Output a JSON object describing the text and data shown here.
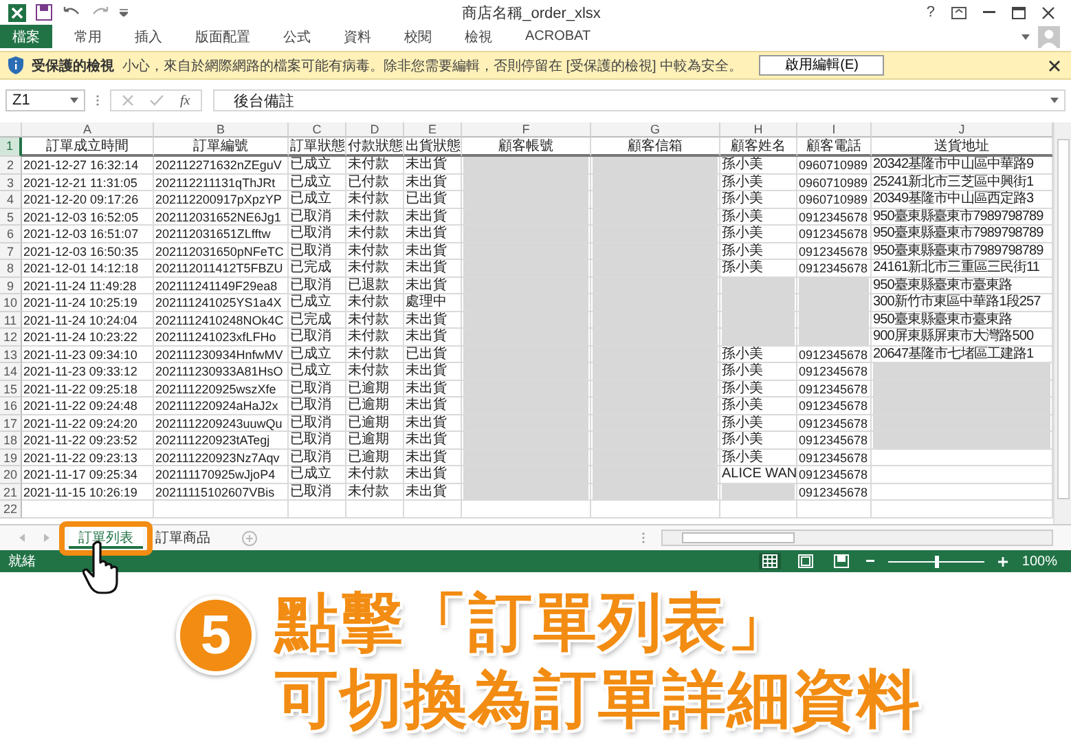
{
  "window": {
    "title": "商店名稱_order_xlsx",
    "help": "?"
  },
  "ribbon": {
    "tabs": [
      {
        "label": "檔案",
        "kind": "file",
        "selected": false
      },
      {
        "label": "常用",
        "kind": "tab",
        "selected": false
      },
      {
        "label": "插入",
        "kind": "tab",
        "selected": false
      },
      {
        "label": "版面配置",
        "kind": "tab",
        "selected": false
      },
      {
        "label": "公式",
        "kind": "tab",
        "selected": false
      },
      {
        "label": "資料",
        "kind": "tab",
        "selected": false
      },
      {
        "label": "校閱",
        "kind": "tab",
        "selected": false
      },
      {
        "label": "檢視",
        "kind": "tab",
        "selected": false
      },
      {
        "label": "ACROBAT",
        "kind": "tab",
        "selected": false
      }
    ]
  },
  "protected_view_bar": {
    "title": "受保護的檢視",
    "message": "小心，來自於網際網路的檔案可能有病毒。除非您需要編輯，否則停留在 [受保護的檢視] 中較為安全。",
    "button": "啟用編輯(E)"
  },
  "formula_bar": {
    "name_box": "Z1",
    "function_button": "fx",
    "value": "後台備註"
  },
  "columns": [
    {
      "letter": "A",
      "heading": "訂單成立時間"
    },
    {
      "letter": "B",
      "heading": "訂單編號"
    },
    {
      "letter": "C",
      "heading": "訂單狀態"
    },
    {
      "letter": "D",
      "heading": "付款狀態"
    },
    {
      "letter": "E",
      "heading": "出貨狀態"
    },
    {
      "letter": "F",
      "heading": "顧客帳號"
    },
    {
      "letter": "G",
      "heading": "顧客信箱"
    },
    {
      "letter": "H",
      "heading": "顧客姓名"
    },
    {
      "letter": "I",
      "heading": "顧客電話"
    },
    {
      "letter": "J",
      "heading": "送貨地址"
    }
  ],
  "header_row": {
    "number": "1",
    "selected": true
  },
  "rows": [
    {
      "number": "2",
      "selected": false,
      "cells": [
        {
          "kind": "text",
          "text": "2021-12-27 16:32:14"
        },
        {
          "kind": "text",
          "text": "202112271632nZEguV"
        },
        {
          "kind": "text",
          "text": "已成立"
        },
        {
          "kind": "text",
          "text": "未付款"
        },
        {
          "kind": "text",
          "text": "未出貨"
        },
        {
          "kind": "blurred"
        },
        {
          "kind": "blurred"
        },
        {
          "kind": "text",
          "text": "孫小美"
        },
        {
          "kind": "text",
          "text": "0960710989"
        },
        {
          "kind": "text",
          "text": "20342基隆市中山區中華路9"
        }
      ]
    },
    {
      "number": "3",
      "selected": false,
      "cells": [
        {
          "kind": "text",
          "text": "2021-12-21 11:31:05"
        },
        {
          "kind": "text",
          "text": "202112211131qThJRt"
        },
        {
          "kind": "text",
          "text": "已成立"
        },
        {
          "kind": "text",
          "text": "已付款"
        },
        {
          "kind": "text",
          "text": "未出貨"
        },
        {
          "kind": "blurred"
        },
        {
          "kind": "blurred"
        },
        {
          "kind": "text",
          "text": "孫小美"
        },
        {
          "kind": "text",
          "text": "0960710989"
        },
        {
          "kind": "text",
          "text": "25241新北市三芝區中興街1"
        }
      ]
    },
    {
      "number": "4",
      "selected": false,
      "cells": [
        {
          "kind": "text",
          "text": "2021-12-20 09:17:26"
        },
        {
          "kind": "text",
          "text": "202112200917pXpzYP"
        },
        {
          "kind": "text",
          "text": "已成立"
        },
        {
          "kind": "text",
          "text": "未付款"
        },
        {
          "kind": "text",
          "text": "已出貨"
        },
        {
          "kind": "blurred"
        },
        {
          "kind": "blurred"
        },
        {
          "kind": "text",
          "text": "孫小美"
        },
        {
          "kind": "text",
          "text": "0960710989"
        },
        {
          "kind": "text",
          "text": "20349基隆市中山區西定路3"
        }
      ]
    },
    {
      "number": "5",
      "selected": false,
      "cells": [
        {
          "kind": "text",
          "text": "2021-12-03 16:52:05"
        },
        {
          "kind": "text",
          "text": "202112031652NE6Jg1"
        },
        {
          "kind": "text",
          "text": "已取消"
        },
        {
          "kind": "text",
          "text": "未付款"
        },
        {
          "kind": "text",
          "text": "未出貨"
        },
        {
          "kind": "blurred"
        },
        {
          "kind": "blurred"
        },
        {
          "kind": "text",
          "text": "孫小美"
        },
        {
          "kind": "text",
          "text": "0912345678"
        },
        {
          "kind": "text",
          "text": "950臺東縣臺東市7989798789"
        }
      ]
    },
    {
      "number": "6",
      "selected": false,
      "cells": [
        {
          "kind": "text",
          "text": "2021-12-03 16:51:07"
        },
        {
          "kind": "text",
          "text": "202112031651ZLfftw"
        },
        {
          "kind": "text",
          "text": "已取消"
        },
        {
          "kind": "text",
          "text": "未付款"
        },
        {
          "kind": "text",
          "text": "未出貨"
        },
        {
          "kind": "blurred"
        },
        {
          "kind": "blurred"
        },
        {
          "kind": "text",
          "text": "孫小美"
        },
        {
          "kind": "text",
          "text": "0912345678"
        },
        {
          "kind": "text",
          "text": "950臺東縣臺東市7989798789"
        }
      ]
    },
    {
      "number": "7",
      "selected": false,
      "cells": [
        {
          "kind": "text",
          "text": "2021-12-03 16:50:35"
        },
        {
          "kind": "text",
          "text": "202112031650pNFeTC"
        },
        {
          "kind": "text",
          "text": "已取消"
        },
        {
          "kind": "text",
          "text": "未付款"
        },
        {
          "kind": "text",
          "text": "未出貨"
        },
        {
          "kind": "blurred"
        },
        {
          "kind": "blurred"
        },
        {
          "kind": "text",
          "text": "孫小美"
        },
        {
          "kind": "text",
          "text": "0912345678"
        },
        {
          "kind": "text",
          "text": "950臺東縣臺東市7989798789"
        }
      ]
    },
    {
      "number": "8",
      "selected": false,
      "cells": [
        {
          "kind": "text",
          "text": "2021-12-01 14:12:18"
        },
        {
          "kind": "text",
          "text": "202112011412T5FBZU"
        },
        {
          "kind": "text",
          "text": "已完成"
        },
        {
          "kind": "text",
          "text": "未付款"
        },
        {
          "kind": "text",
          "text": "未出貨"
        },
        {
          "kind": "blurred"
        },
        {
          "kind": "blurred"
        },
        {
          "kind": "text",
          "text": "孫小美"
        },
        {
          "kind": "text",
          "text": "0912345678"
        },
        {
          "kind": "text",
          "text": "24161新北市三重區三民街11"
        }
      ]
    },
    {
      "number": "9",
      "selected": false,
      "cells": [
        {
          "kind": "text",
          "text": "2021-11-24 11:49:28"
        },
        {
          "kind": "text",
          "text": "202111241149F29ea8"
        },
        {
          "kind": "text",
          "text": "已取消"
        },
        {
          "kind": "text",
          "text": "已退款"
        },
        {
          "kind": "text",
          "text": "未出貨"
        },
        {
          "kind": "blurred"
        },
        {
          "kind": "blurred"
        },
        {
          "kind": "blurred"
        },
        {
          "kind": "blurred"
        },
        {
          "kind": "text",
          "text": "950臺東縣臺東市臺東路"
        }
      ]
    },
    {
      "number": "10",
      "selected": false,
      "cells": [
        {
          "kind": "text",
          "text": "2021-11-24 10:25:19"
        },
        {
          "kind": "text",
          "text": "202111241025YS1a4X"
        },
        {
          "kind": "text",
          "text": "已成立"
        },
        {
          "kind": "text",
          "text": "未付款"
        },
        {
          "kind": "text",
          "text": "處理中"
        },
        {
          "kind": "blurred"
        },
        {
          "kind": "blurred"
        },
        {
          "kind": "blurred"
        },
        {
          "kind": "blurred"
        },
        {
          "kind": "text",
          "text": "300新竹市東區中華路1段257"
        }
      ]
    },
    {
      "number": "11",
      "selected": false,
      "cells": [
        {
          "kind": "text",
          "text": "2021-11-24 10:24:04"
        },
        {
          "kind": "text",
          "text": "2021112410248NOk4C"
        },
        {
          "kind": "text",
          "text": "已完成"
        },
        {
          "kind": "text",
          "text": "未付款"
        },
        {
          "kind": "text",
          "text": "未出貨"
        },
        {
          "kind": "blurred"
        },
        {
          "kind": "blurred"
        },
        {
          "kind": "blurred"
        },
        {
          "kind": "blurred"
        },
        {
          "kind": "text",
          "text": "950臺東縣臺東市臺東路"
        }
      ]
    },
    {
      "number": "12",
      "selected": false,
      "cells": [
        {
          "kind": "text",
          "text": "2021-11-24 10:23:22"
        },
        {
          "kind": "text",
          "text": "202111241023xfLFHo"
        },
        {
          "kind": "text",
          "text": "已取消"
        },
        {
          "kind": "text",
          "text": "未付款"
        },
        {
          "kind": "text",
          "text": "未出貨"
        },
        {
          "kind": "blurred"
        },
        {
          "kind": "blurred"
        },
        {
          "kind": "blurred"
        },
        {
          "kind": "blurred"
        },
        {
          "kind": "text",
          "text": "900屏東縣屏東市大灣路500"
        }
      ]
    },
    {
      "number": "13",
      "selected": false,
      "cells": [
        {
          "kind": "text",
          "text": "2021-11-23 09:34:10"
        },
        {
          "kind": "text",
          "text": "202111230934HnfwMV"
        },
        {
          "kind": "text",
          "text": "已成立"
        },
        {
          "kind": "text",
          "text": "未付款"
        },
        {
          "kind": "text",
          "text": "已出貨"
        },
        {
          "kind": "blurred"
        },
        {
          "kind": "blurred"
        },
        {
          "kind": "text",
          "text": "孫小美"
        },
        {
          "kind": "text",
          "text": "0912345678"
        },
        {
          "kind": "text",
          "text": "20647基隆市七堵區工建路1"
        }
      ]
    },
    {
      "number": "14",
      "selected": false,
      "cells": [
        {
          "kind": "text",
          "text": "2021-11-23 09:33:12"
        },
        {
          "kind": "text",
          "text": "202111230933A81HsO"
        },
        {
          "kind": "text",
          "text": "已成立"
        },
        {
          "kind": "text",
          "text": "未付款"
        },
        {
          "kind": "text",
          "text": "未出貨"
        },
        {
          "kind": "blurred"
        },
        {
          "kind": "blurred"
        },
        {
          "kind": "text",
          "text": "孫小美"
        },
        {
          "kind": "text",
          "text": "0912345678"
        },
        {
          "kind": "blurred"
        }
      ]
    },
    {
      "number": "15",
      "selected": false,
      "cells": [
        {
          "kind": "text",
          "text": "2021-11-22 09:25:18"
        },
        {
          "kind": "text",
          "text": "202111220925wszXfe"
        },
        {
          "kind": "text",
          "text": "已取消"
        },
        {
          "kind": "text",
          "text": "已逾期"
        },
        {
          "kind": "text",
          "text": "未出貨"
        },
        {
          "kind": "blurred"
        },
        {
          "kind": "blurred"
        },
        {
          "kind": "text",
          "text": "孫小美"
        },
        {
          "kind": "text",
          "text": "0912345678"
        },
        {
          "kind": "blurred"
        }
      ]
    },
    {
      "number": "16",
      "selected": false,
      "cells": [
        {
          "kind": "text",
          "text": "2021-11-22 09:24:48"
        },
        {
          "kind": "text",
          "text": "202111220924aHaJ2x"
        },
        {
          "kind": "text",
          "text": "已取消"
        },
        {
          "kind": "text",
          "text": "已逾期"
        },
        {
          "kind": "text",
          "text": "未出貨"
        },
        {
          "kind": "blurred"
        },
        {
          "kind": "blurred"
        },
        {
          "kind": "text",
          "text": "孫小美"
        },
        {
          "kind": "text",
          "text": "0912345678"
        },
        {
          "kind": "blurred"
        }
      ]
    },
    {
      "number": "17",
      "selected": false,
      "cells": [
        {
          "kind": "text",
          "text": "2021-11-22 09:24:20"
        },
        {
          "kind": "text",
          "text": "2021112209243uuwQu"
        },
        {
          "kind": "text",
          "text": "已取消"
        },
        {
          "kind": "text",
          "text": "已逾期"
        },
        {
          "kind": "text",
          "text": "未出貨"
        },
        {
          "kind": "blurred"
        },
        {
          "kind": "blurred"
        },
        {
          "kind": "text",
          "text": "孫小美"
        },
        {
          "kind": "text",
          "text": "0912345678"
        },
        {
          "kind": "blurred"
        }
      ]
    },
    {
      "number": "18",
      "selected": false,
      "cells": [
        {
          "kind": "text",
          "text": "2021-11-22 09:23:52"
        },
        {
          "kind": "text",
          "text": "202111220923tATegj"
        },
        {
          "kind": "text",
          "text": "已取消"
        },
        {
          "kind": "text",
          "text": "已逾期"
        },
        {
          "kind": "text",
          "text": "未出貨"
        },
        {
          "kind": "blurred"
        },
        {
          "kind": "blurred"
        },
        {
          "kind": "text",
          "text": "孫小美"
        },
        {
          "kind": "text",
          "text": "0912345678"
        },
        {
          "kind": "blurred"
        }
      ]
    },
    {
      "number": "19",
      "selected": false,
      "cells": [
        {
          "kind": "text",
          "text": "2021-11-22 09:23:13"
        },
        {
          "kind": "text",
          "text": "202111220923Nz7Aqv"
        },
        {
          "kind": "text",
          "text": "已取消"
        },
        {
          "kind": "text",
          "text": "已逾期"
        },
        {
          "kind": "text",
          "text": "未出貨"
        },
        {
          "kind": "blurred"
        },
        {
          "kind": "blurred"
        },
        {
          "kind": "text",
          "text": "孫小美"
        },
        {
          "kind": "text",
          "text": "0912345678"
        },
        {
          "kind": "empty"
        }
      ]
    },
    {
      "number": "20",
      "selected": false,
      "cells": [
        {
          "kind": "text",
          "text": "2021-11-17 09:25:34"
        },
        {
          "kind": "text",
          "text": "202111170925wJjoP4"
        },
        {
          "kind": "text",
          "text": "已成立"
        },
        {
          "kind": "text",
          "text": "未付款"
        },
        {
          "kind": "text",
          "text": "未出貨"
        },
        {
          "kind": "blurred"
        },
        {
          "kind": "blurred"
        },
        {
          "kind": "text",
          "text": "ALICE WAN"
        },
        {
          "kind": "text",
          "text": "0912345678"
        },
        {
          "kind": "empty"
        }
      ]
    },
    {
      "number": "21",
      "selected": false,
      "cells": [
        {
          "kind": "text",
          "text": "2021-11-15 10:26:19"
        },
        {
          "kind": "text",
          "text": "20211115102607VBis"
        },
        {
          "kind": "text",
          "text": "已取消"
        },
        {
          "kind": "text",
          "text": "未付款"
        },
        {
          "kind": "text",
          "text": "未出貨"
        },
        {
          "kind": "blurred"
        },
        {
          "kind": "blurred"
        },
        {
          "kind": "blurred"
        },
        {
          "kind": "text",
          "text": "0912345678"
        },
        {
          "kind": "empty"
        }
      ]
    },
    {
      "number": "22",
      "selected": false
    }
  ],
  "sheet_tabs": [
    {
      "label": "訂單列表",
      "selected": true,
      "highlighted": true
    },
    {
      "label": "訂單商品",
      "selected": false,
      "highlighted": false
    }
  ],
  "status_bar": {
    "status": "就緒",
    "zoom": {
      "level": 0.5,
      "reading": "100%"
    }
  },
  "annotation": {
    "step": "5",
    "lines": [
      "點擊「訂單列表」",
      "可切換為訂單詳細資料"
    ]
  }
}
